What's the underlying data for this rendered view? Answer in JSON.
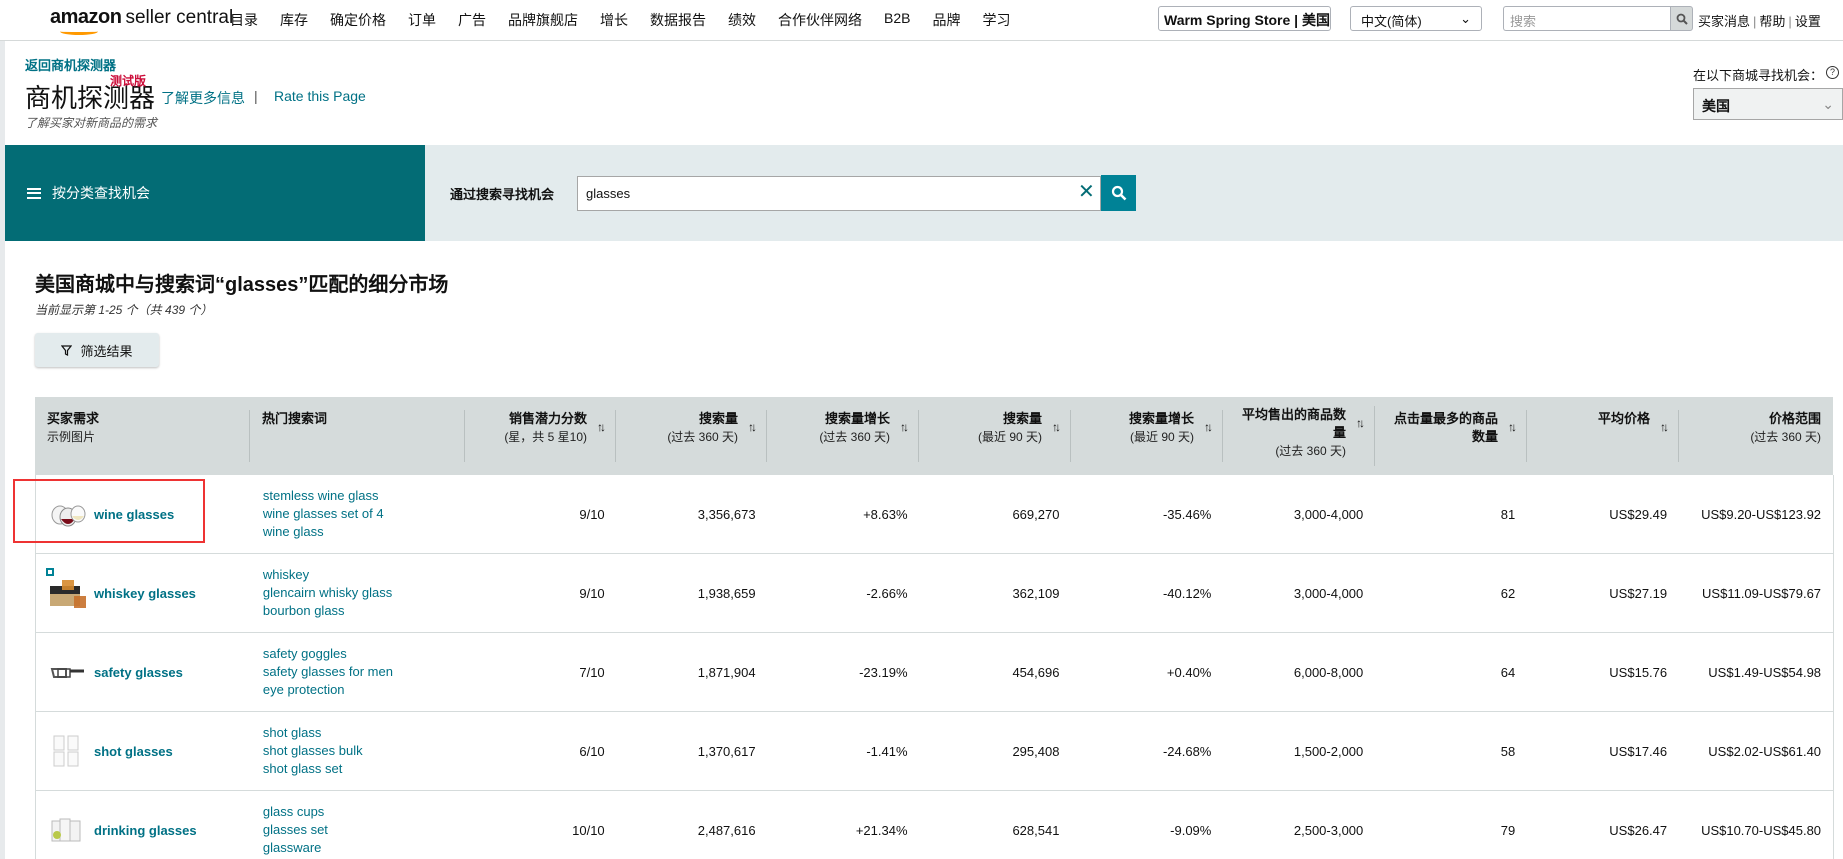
{
  "topnav": {
    "logo_brand": "amazon",
    "logo_product": "seller central",
    "links": [
      "目录",
      "库存",
      "确定价格",
      "订单",
      "广告",
      "品牌旗舰店",
      "增长",
      "数据报告",
      "绩效",
      "合作伙伴网络",
      "B2B",
      "品牌",
      "学习"
    ],
    "store": "Warm Spring Store | 美国",
    "language": "中文(简体)",
    "search_placeholder": "搜索",
    "right_links": [
      "买家消息",
      "帮助",
      "设置"
    ]
  },
  "header": {
    "back_link": "返回商机探测器",
    "title": "商机探测器",
    "beta_tag": "测试版",
    "learn_more": "了解更多信息",
    "separator": "|",
    "rate_page": "Rate this Page",
    "subtitle": "了解买家对新商品的需求",
    "marketplace_label": "在以下商城寻找机会：",
    "marketplace_value": "美国"
  },
  "search_band": {
    "category_button": "按分类查找机会",
    "search_label": "通过搜索寻找机会",
    "search_value": "glasses"
  },
  "results": {
    "title": "美国商城中与搜索词“glasses”匹配的细分市场",
    "count": "当前显示第 1-25 个（共 439 个）",
    "filter_button": "筛选结果"
  },
  "table": {
    "columns": [
      {
        "label": "买家需求",
        "sub": "示例图片",
        "sortable": false
      },
      {
        "label": "热门搜索词",
        "sub": "",
        "sortable": false
      },
      {
        "label": "销售潜力分数",
        "sub": "(星，共 5 星10)",
        "sortable": true
      },
      {
        "label": "搜索量",
        "sub": "(过去 360 天)",
        "sortable": true
      },
      {
        "label": "搜索量增长",
        "sub": "(过去 360 天)",
        "sortable": true
      },
      {
        "label": "搜索量",
        "sub": "(最近 90 天)",
        "sortable": true
      },
      {
        "label": "搜索量增长",
        "sub": "(最近 90 天)",
        "sortable": true
      },
      {
        "label": "平均售出的商品数量",
        "sub": "(过去 360 天)",
        "sortable": true
      },
      {
        "label": "点击量最多的商品数量",
        "sub": "",
        "sortable": true
      },
      {
        "label": "平均价格",
        "sub": "",
        "sortable": true
      },
      {
        "label": "价格范围",
        "sub": "(过去 360 天)",
        "sortable": false
      }
    ],
    "rows": [
      {
        "need": "wine glasses",
        "image": "wine-glasses-thumbnail",
        "keywords": [
          "stemless wine glass",
          "wine glasses set of 4",
          "wine glass"
        ],
        "score": "9/10",
        "search_360": "3,356,673",
        "growth_360": "+8.63%",
        "search_90": "669,270",
        "growth_90": "-35.46%",
        "units_sold": "3,000-4,000",
        "top_clicked": "81",
        "avg_price": "US$29.49",
        "price_range": "US$9.20-US$123.92"
      },
      {
        "need": "whiskey glasses",
        "image": "whiskey-glasses-thumbnail",
        "keywords": [
          "whiskey",
          "glencairn whisky glass",
          "bourbon glass"
        ],
        "score": "9/10",
        "search_360": "1,938,659",
        "growth_360": "-2.66%",
        "search_90": "362,109",
        "growth_90": "-40.12%",
        "units_sold": "3,000-4,000",
        "top_clicked": "62",
        "avg_price": "US$27.19",
        "price_range": "US$11.09-US$79.67"
      },
      {
        "need": "safety glasses",
        "image": "safety-glasses-thumbnail",
        "keywords": [
          "safety goggles",
          "safety glasses for men",
          "eye protection"
        ],
        "score": "7/10",
        "search_360": "1,871,904",
        "growth_360": "-23.19%",
        "search_90": "454,696",
        "growth_90": "+0.40%",
        "units_sold": "6,000-8,000",
        "top_clicked": "64",
        "avg_price": "US$15.76",
        "price_range": "US$1.49-US$54.98"
      },
      {
        "need": "shot glasses",
        "image": "shot-glasses-thumbnail",
        "keywords": [
          "shot glass",
          "shot glasses bulk",
          "shot glass set"
        ],
        "score": "6/10",
        "search_360": "1,370,617",
        "growth_360": "-1.41%",
        "search_90": "295,408",
        "growth_90": "-24.68%",
        "units_sold": "1,500-2,000",
        "top_clicked": "58",
        "avg_price": "US$17.46",
        "price_range": "US$2.02-US$61.40"
      },
      {
        "need": "drinking glasses",
        "image": "drinking-glasses-thumbnail",
        "keywords": [
          "glass cups",
          "glasses set",
          "glassware"
        ],
        "score": "10/10",
        "search_360": "2,487,616",
        "growth_360": "+21.34%",
        "search_90": "628,541",
        "growth_90": "-9.09%",
        "units_sold": "2,500-3,000",
        "top_clicked": "79",
        "avg_price": "US$26.47",
        "price_range": "US$10.70-US$45.80"
      }
    ]
  },
  "colors": {
    "teal_dark": "#036c75",
    "teal_button": "#008296",
    "link": "#007185",
    "band_bg": "#e3ebed",
    "table_header_bg": "#d5dbdb",
    "highlight": "#ee3333",
    "beta": "#cc0c39",
    "logo_smile": "#ff9900"
  }
}
